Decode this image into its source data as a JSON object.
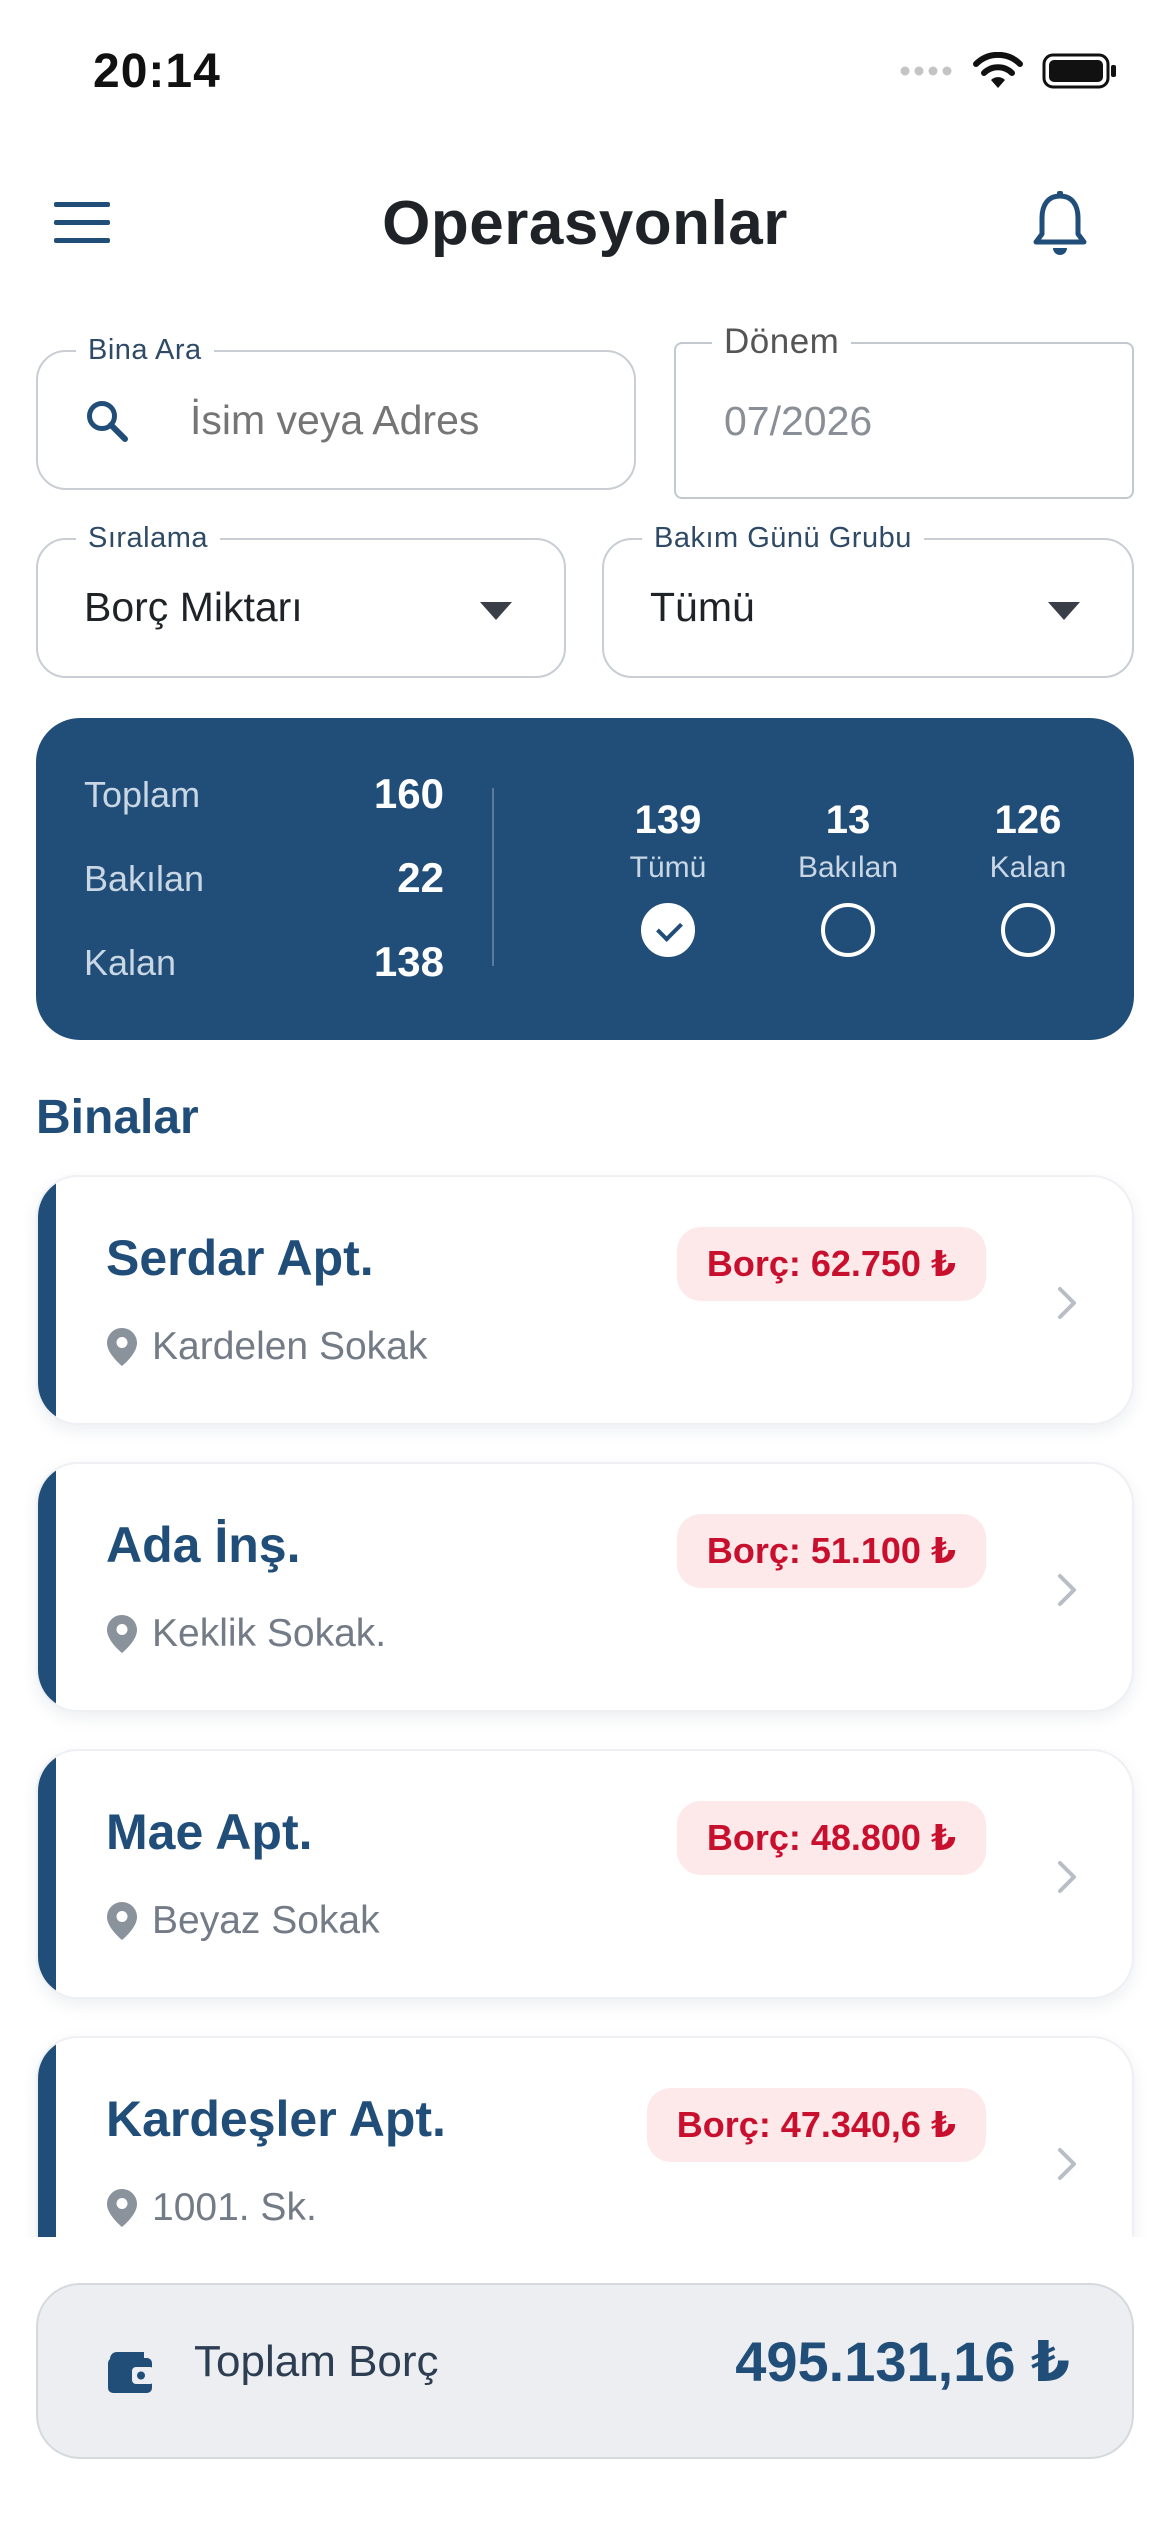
{
  "status_bar": {
    "time": "20:14"
  },
  "header": {
    "title": "Operasyonlar",
    "menu_icon": "hamburger-menu-icon",
    "notification_icon": "bell-icon"
  },
  "filters": {
    "search": {
      "label": "Bina Ara",
      "placeholder": "İsim veya Adres",
      "value": ""
    },
    "period": {
      "label": "Dönem",
      "value": "07/2026"
    },
    "sort": {
      "label": "Sıralama",
      "value": "Borç Miktarı"
    },
    "maintenance_group": {
      "label": "Bakım Günü Grubu",
      "value": "Tümü"
    }
  },
  "summary": {
    "rows": [
      {
        "label": "Toplam",
        "value": "160"
      },
      {
        "label": "Bakılan",
        "value": "22"
      },
      {
        "label": "Kalan",
        "value": "138"
      }
    ],
    "filter_options": [
      {
        "count": "139",
        "label": "Tümü",
        "selected": true
      },
      {
        "count": "13",
        "label": "Bakılan",
        "selected": false
      },
      {
        "count": "126",
        "label": "Kalan",
        "selected": false
      }
    ]
  },
  "section_title": "Binalar",
  "buildings": [
    {
      "name": "Serdar Apt.",
      "address": "Kardelen Sokak",
      "debt": "Borç: 62.750 ₺"
    },
    {
      "name": "Ada İnş.",
      "address": "Keklik Sokak.",
      "debt": "Borç: 51.100 ₺"
    },
    {
      "name": "Mae Apt.",
      "address": "Beyaz Sokak",
      "debt": "Borç: 48.800 ₺"
    },
    {
      "name": "Kardeşler Apt.",
      "address": "1001. Sk.",
      "debt": "Borç: 47.340,6 ₺"
    }
  ],
  "total": {
    "label": "Toplam Borç",
    "value": "495.131,16 ₺",
    "icon": "wallet-icon"
  },
  "colors": {
    "primary": "#214e79",
    "debt_text": "#c8102e",
    "debt_bg": "#fde8ea",
    "surface": "#eceef1"
  }
}
